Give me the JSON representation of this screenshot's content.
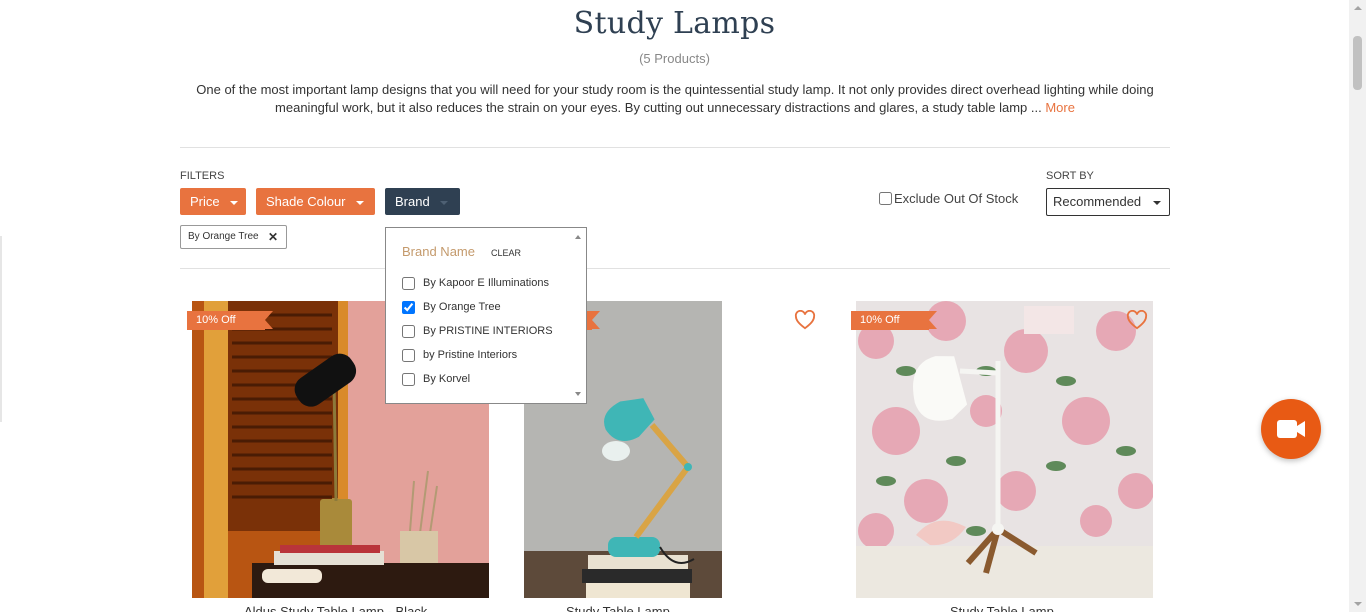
{
  "header": {
    "title": "Study Lamps",
    "product_count": "(5 Products)",
    "description": "One of the most important lamp designs that you will need for your study room is the quintessential study lamp. It not only provides direct overhead lighting while doing meaningful work, but it also reduces the strain on your eyes. By cutting out unnecessary distractions and glares, a study table lamp ... ",
    "more_label": "More"
  },
  "filters": {
    "label": "FILTERS",
    "buttons": [
      {
        "label": "Price"
      },
      {
        "label": "Shade Colour"
      },
      {
        "label": "Brand"
      }
    ],
    "applied": [
      {
        "label": "By Orange Tree",
        "remove": "✕"
      }
    ],
    "exclude_out_of_stock": {
      "label": "Exclude Out Of Stock",
      "checked": false
    }
  },
  "sort": {
    "label": "SORT BY",
    "selected": "Recommended"
  },
  "brand_dropdown": {
    "header": "Brand Name",
    "clear_label": "CLEAR",
    "options": [
      {
        "label": "By Kapoor E Illuminations",
        "checked": false
      },
      {
        "label": "By Orange Tree",
        "checked": true
      },
      {
        "label": "By PRISTINE INTERIORS",
        "checked": false
      },
      {
        "label": "by Pristine Interiors",
        "checked": false
      },
      {
        "label": "By Korvel",
        "checked": false
      }
    ]
  },
  "products": [
    {
      "discount": "10% Off",
      "title": "Aldus Study Table Lamp - Black"
    },
    {
      "discount": "",
      "title": "Study Table Lamp"
    },
    {
      "discount": "10% Off",
      "title": "Study Table Lamp"
    }
  ],
  "colors": {
    "accent": "#e8733f",
    "dark": "#2f4052",
    "video": "#e85a14"
  },
  "icons": {
    "wishlist": "heart-outline-icon",
    "video": "video-camera-icon",
    "remove": "close-icon"
  }
}
